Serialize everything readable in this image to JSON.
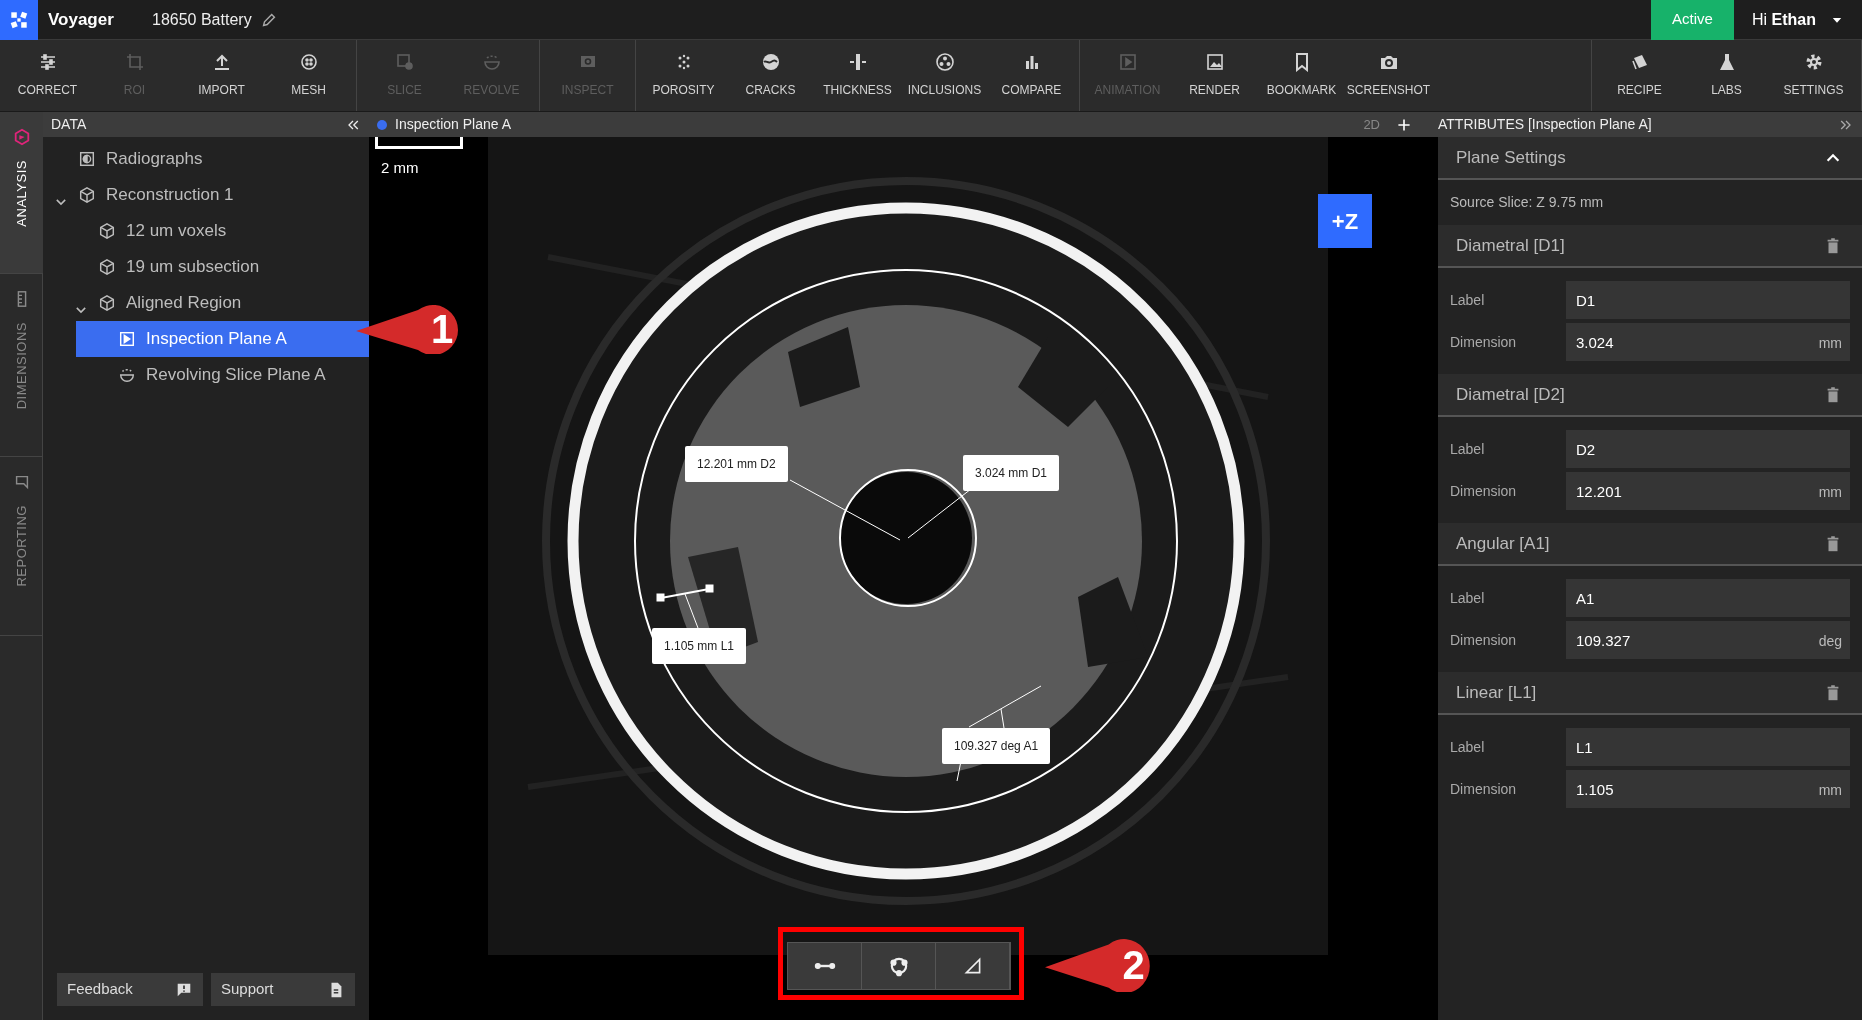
{
  "app": {
    "name": "Voyager",
    "project": "18650 Battery",
    "status": "Active",
    "greeting": "Hi **Ethan**"
  },
  "toolbar": {
    "groups": [
      [
        {
          "label": "CORRECT",
          "disabled": false
        },
        {
          "label": "ROI",
          "disabled": true
        },
        {
          "label": "IMPORT",
          "disabled": false
        },
        {
          "label": "MESH",
          "disabled": false
        }
      ],
      [
        {
          "label": "SLICE",
          "disabled": true
        },
        {
          "label": "REVOLVE",
          "disabled": true
        }
      ],
      [
        {
          "label": "INSPECT",
          "disabled": true
        }
      ],
      [
        {
          "label": "POROSITY",
          "disabled": false
        },
        {
          "label": "CRACKS",
          "disabled": false
        },
        {
          "label": "THICKNESS",
          "disabled": false
        },
        {
          "label": "INCLUSIONS",
          "disabled": false
        },
        {
          "label": "COMPARE",
          "disabled": false
        }
      ],
      [
        {
          "label": "ANIMATION",
          "disabled": true
        },
        {
          "label": "RENDER",
          "disabled": false
        },
        {
          "label": "BOOKMARK",
          "disabled": false
        },
        {
          "label": "SCREENSHOT",
          "disabled": false
        }
      ],
      [
        {
          "label": "RECIPE",
          "disabled": false
        },
        {
          "label": "LABS",
          "disabled": false
        },
        {
          "label": "SETTINGS",
          "disabled": false
        }
      ]
    ]
  },
  "side_tabs": [
    {
      "label": "ANALYSIS",
      "selected": true
    },
    {
      "label": "DIMENSIONS",
      "selected": false
    },
    {
      "label": "REPORTING",
      "selected": false
    }
  ],
  "data_panel": {
    "title": "DATA",
    "tree": [
      {
        "label": "Radiographs",
        "kind": "radiograph",
        "selected": false
      },
      {
        "label": "Reconstruction 1",
        "kind": "volume",
        "selected": false,
        "expanded": true,
        "children": [
          {
            "label": "12 um voxels",
            "kind": "volume",
            "selected": false
          },
          {
            "label": "19 um subsection",
            "kind": "volume",
            "selected": false
          },
          {
            "label": "Aligned Region",
            "kind": "volume",
            "selected": false,
            "expanded": true,
            "children": [
              {
                "label": "Inspection Plane A",
                "kind": "plane",
                "selected": true
              },
              {
                "label": "Revolving Slice Plane A",
                "kind": "revolve",
                "selected": false
              }
            ]
          }
        ]
      }
    ],
    "footer_buttons": [
      "Feedback",
      "Support"
    ]
  },
  "viewport": {
    "title": "Inspection Plane A",
    "mode": "2D",
    "scale": "2 mm",
    "axis": "+Z",
    "measurements": [
      "12.201 mm D2",
      "3.024 mm D1",
      "1.105 mm L1",
      "109.327 deg A1"
    ]
  },
  "attributes": {
    "title": "ATTRIBUTES [Inspection Plane A]",
    "plane_settings": {
      "title": "Plane Settings",
      "expanded": true,
      "source": "Source Slice: Z 9.75 mm"
    },
    "measurements": [
      {
        "title": "Diametral [D1]",
        "label_caption": "Label",
        "label": "D1",
        "dimension_caption": "Dimension",
        "dimension": "3.024",
        "unit": "mm"
      },
      {
        "title": "Diametral [D2]",
        "label_caption": "Label",
        "label": "D2",
        "dimension_caption": "Dimension",
        "dimension": "12.201",
        "unit": "mm"
      },
      {
        "title": "Angular [A1]",
        "label_caption": "Label",
        "label": "A1",
        "dimension_caption": "Dimension",
        "dimension": "109.327",
        "unit": "deg"
      },
      {
        "title": "Linear [L1]",
        "label_caption": "Label",
        "label": "L1",
        "dimension_caption": "Dimension",
        "dimension": "1.105",
        "unit": "mm"
      }
    ]
  },
  "callouts": [
    "1",
    "2"
  ]
}
